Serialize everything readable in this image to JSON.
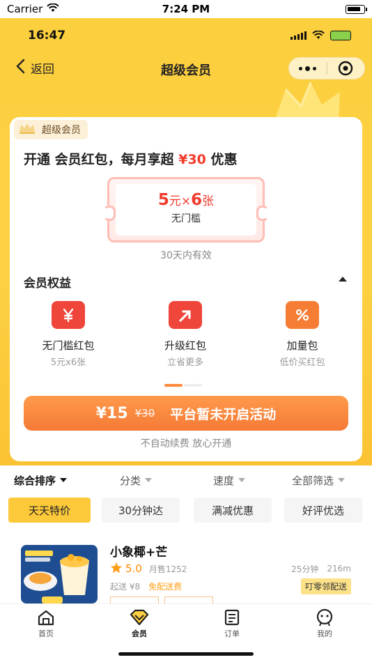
{
  "ios_status": {
    "carrier": "Carrier",
    "time": "7:24 PM"
  },
  "app_status": {
    "time": "16:47"
  },
  "nav": {
    "back_label": "返回",
    "title": "超级会员"
  },
  "card": {
    "tag": "超级会员",
    "headline_prefix": "开通 会员红包，每月享超 ",
    "headline_amount": "¥30",
    "headline_suffix": " 优惠",
    "coupon": {
      "amount": "5",
      "unit": "元×",
      "count": "6",
      "count_unit": "张",
      "condition": "无门槛"
    },
    "validity": "30天内有效",
    "benefits_title": "会员权益",
    "benefits": [
      {
        "icon": "yen-voucher-icon",
        "label": "无门槛红包",
        "sub": "5元x6张",
        "color": "#f0453a"
      },
      {
        "icon": "upgrade-arrow-icon",
        "label": "升级红包",
        "sub": "立省更多",
        "color": "#f0453a"
      },
      {
        "icon": "percent-coupon-icon",
        "label": "加量包",
        "sub": "低价买红包",
        "color": "#f67d34"
      }
    ],
    "cta": {
      "price": "¥15",
      "original": "¥30",
      "action": "平台暂未开启活动"
    },
    "cta_note": "不自动续费 放心开通"
  },
  "filters": [
    "综合排序",
    "分类",
    "速度",
    "全部筛选"
  ],
  "chips": [
    "天天特价",
    "30分钟达",
    "满减优惠",
    "好评优选"
  ],
  "shop": {
    "name": "小象椰+芒",
    "rating": "5.0",
    "monthly_sales": "月售1252",
    "time": "25分钟",
    "distance": "216m",
    "min_order": "起送 ¥8",
    "free_delivery": "免配送费",
    "delivery_badge": "叮零邻配送"
  },
  "tabbar": [
    {
      "label": "首页",
      "icon": "home-icon"
    },
    {
      "label": "会员",
      "icon": "diamond-icon"
    },
    {
      "label": "订单",
      "icon": "order-list-icon"
    },
    {
      "label": "我的",
      "icon": "profile-face-icon"
    }
  ],
  "colors": {
    "brand_yellow": "#fccf3e",
    "accent_red": "#f23a2a",
    "cta_orange": "#f57a35"
  }
}
